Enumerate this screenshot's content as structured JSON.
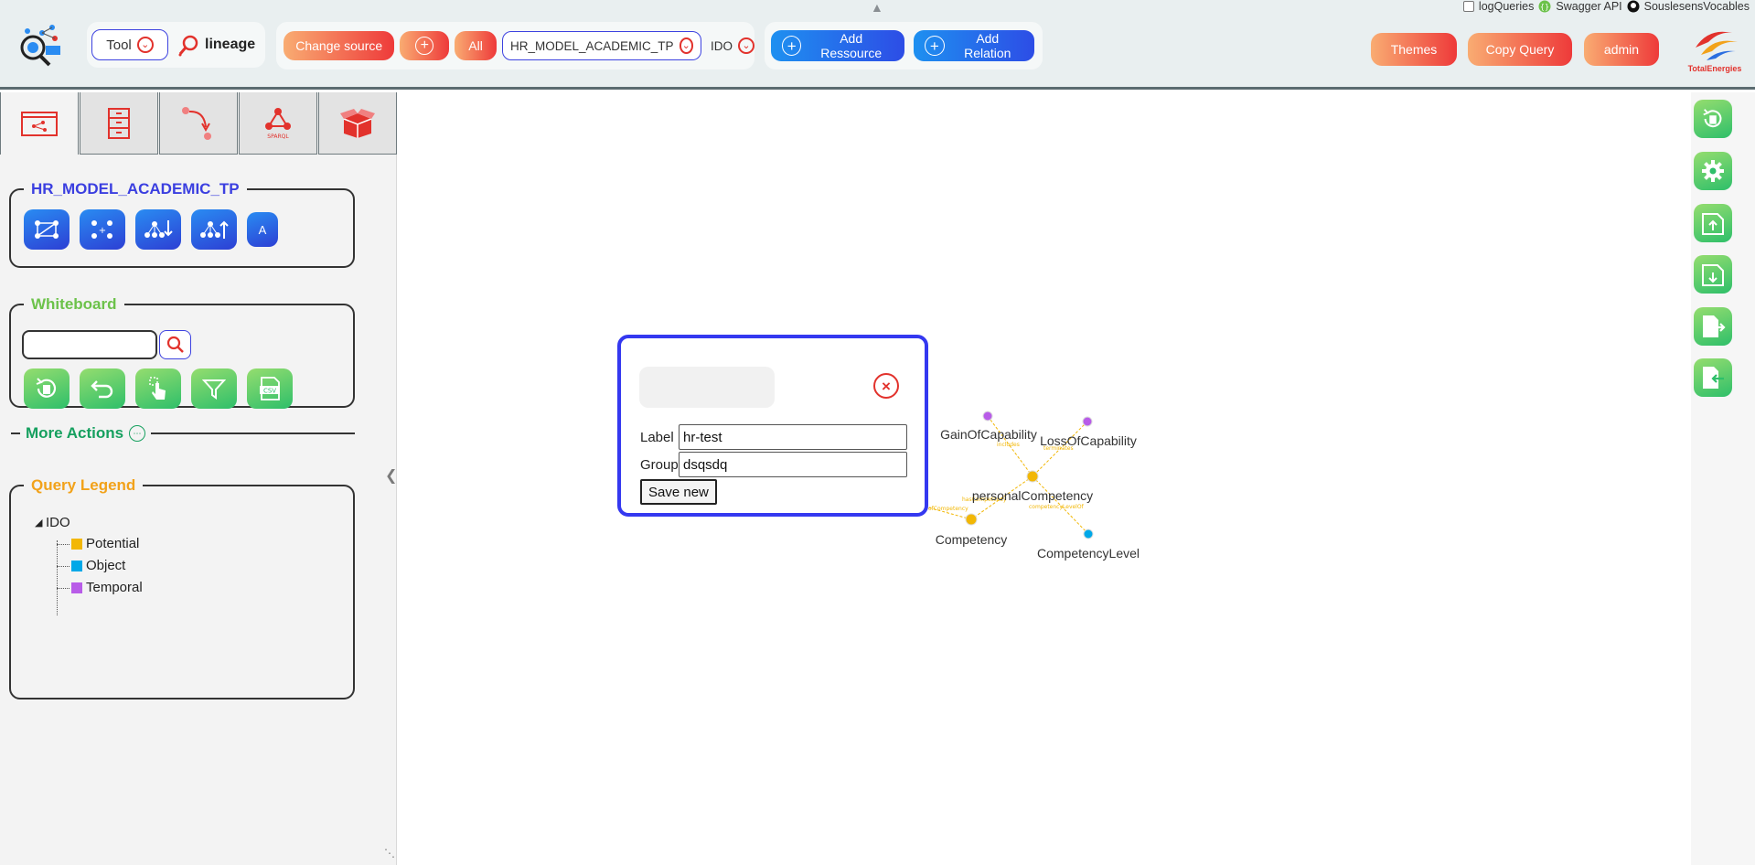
{
  "toolbar": {
    "tool_label": "Tool",
    "lineage_label": "lineage",
    "change_source_label": "Change source",
    "all_label": "All",
    "source_selected": "HR_MODEL_ACADEMIC_TP",
    "ido_label": "IDO",
    "add_ressource_label": "Add Ressource",
    "add_relation_label": "Add Relation",
    "themes_label": "Themes",
    "copy_query_label": "Copy Query",
    "admin_label": "admin"
  },
  "top_links": {
    "log_queries": "logQueries",
    "swagger": "Swagger API",
    "souslesens": "SouslesensVocables"
  },
  "brand": {
    "name": "TotalEnergies"
  },
  "sidebar": {
    "model_title": "HR_MODEL_ACADEMIC_TP",
    "model_small_button": "A",
    "whiteboard_title": "Whiteboard",
    "more_actions_label": "More Actions",
    "legend_title": "Query Legend",
    "legend_root": "IDO",
    "legend_items": [
      {
        "label": "Potential",
        "color": "#f2b705"
      },
      {
        "label": "Object",
        "color": "#00a8e8"
      },
      {
        "label": "Temporal",
        "color": "#b85ce8"
      }
    ]
  },
  "dialog": {
    "label_caption": "Label",
    "label_value": "hr-test",
    "group_caption": "Group",
    "group_value": "dsqsdq",
    "save_label": "Save new"
  },
  "graph": {
    "nodes": {
      "gain": "GainOfCapability",
      "loss": "LossOfCapability",
      "personal": "personalCompetency",
      "competency": "Competency",
      "level": "CompetencyLevel"
    },
    "edges": {
      "e1": "includes",
      "e2": "terminates",
      "e3": "hasCompetency",
      "e4": "competencyLevelOf",
      "e5": "ofCompetency"
    }
  },
  "colors": {
    "accent_blue": "#3438f0",
    "accent_orange": "#ee3a3a",
    "accent_green": "#2ebf6a",
    "edge": "#f2b705"
  }
}
